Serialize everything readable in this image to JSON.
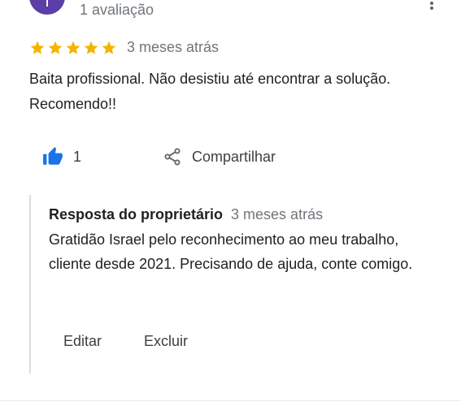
{
  "reviewer": {
    "avatar_letter": "I",
    "review_count": "1 avaliação"
  },
  "review": {
    "stars": 5,
    "date": "3 meses atrás",
    "text": "Baita profissional. Não desistiu até encontrar a solução. Recomendo!!"
  },
  "actions": {
    "like_count": "1",
    "share_label": "Compartilhar"
  },
  "reply": {
    "title": "Resposta do proprietário",
    "date": "3 meses atrás",
    "text": "Gratidão Israel pelo reconhecimento ao meu trabalho, cliente desde 2021. Precisando de ajuda, conte comigo.",
    "edit_label": "Editar",
    "delete_label": "Excluir"
  },
  "colors": {
    "star": "#f4b400",
    "like": "#1a73e8",
    "avatar": "#5b3fa6"
  },
  "icons": [
    "more-vert-icon",
    "star-icon",
    "thumbs-up-icon",
    "share-icon"
  ]
}
